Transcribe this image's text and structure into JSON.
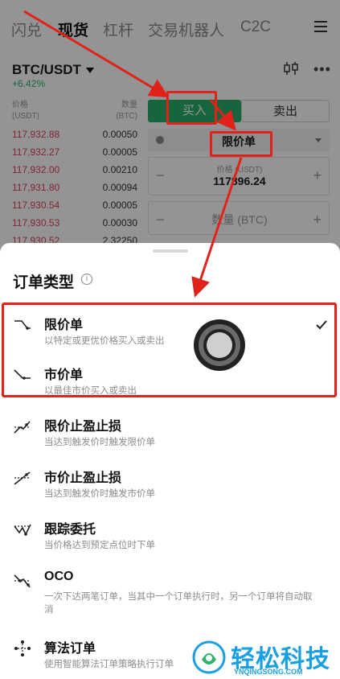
{
  "nav": {
    "tabs": [
      "闪兑",
      "现货",
      "杠杆",
      "交易机器人",
      "C2C"
    ],
    "active_tab": "现货"
  },
  "market": {
    "pair": "BTC/USDT",
    "change": "+6.42%"
  },
  "orderbook": {
    "price_header": "价格",
    "price_unit": "(USDT)",
    "qty_header": "数量",
    "qty_unit": "(BTC)",
    "rows": [
      {
        "price": "117,932.88",
        "qty": "0.00050"
      },
      {
        "price": "117,932.27",
        "qty": "0.00005"
      },
      {
        "price": "117,932.00",
        "qty": "0.00210"
      },
      {
        "price": "117,931.80",
        "qty": "0.00094"
      },
      {
        "price": "117,930.54",
        "qty": "0.00005"
      },
      {
        "price": "117,930.53",
        "qty": "0.00030"
      },
      {
        "price": "117,930.52",
        "qty": "2.32250"
      }
    ]
  },
  "trade_form": {
    "buy_label": "买入",
    "sell_label": "卖出",
    "order_type_selected": "限价单",
    "price_caption": "价格 (USDT)",
    "price_value": "117896.24",
    "qty_caption": "数量 (BTC)",
    "minus": "−",
    "plus": "+"
  },
  "sheet": {
    "title": "订单类型",
    "info_glyph": "i",
    "options": [
      {
        "name": "限价单",
        "desc": "以特定或更优价格买入或卖出",
        "icon": "limit-order-icon",
        "selected": true
      },
      {
        "name": "市价单",
        "desc": "以最佳市价买入或卖出",
        "icon": "market-order-icon",
        "selected": false
      },
      {
        "name": "限价止盈止损",
        "desc": "当达到触发价时触发限价单",
        "icon": "stop-limit-icon",
        "selected": false
      },
      {
        "name": "市价止盈止损",
        "desc": "当达到触发价时触发市价单",
        "icon": "stop-market-icon",
        "selected": false
      },
      {
        "name": "跟踪委托",
        "desc": "当价格达到预定点位时下单",
        "icon": "trailing-stop-icon",
        "selected": false
      },
      {
        "name": "OCO",
        "desc": "一次下达两笔订单，当其中一个订单执行时，另一个订单将自动取消",
        "icon": "oco-icon",
        "selected": false
      },
      {
        "name": "算法订单",
        "desc": "使用智能算法订单策略执行订单",
        "icon": "algo-order-icon",
        "selected": false
      }
    ]
  },
  "watermark": {
    "brand": "轻松科技",
    "domain": "YNQINGSONG.COM"
  },
  "colors": {
    "buy_green": "#27ae6a",
    "ask_red": "#e0405c",
    "annotation_red": "#e0231a",
    "watermark_blue": "#1aa0e0"
  }
}
